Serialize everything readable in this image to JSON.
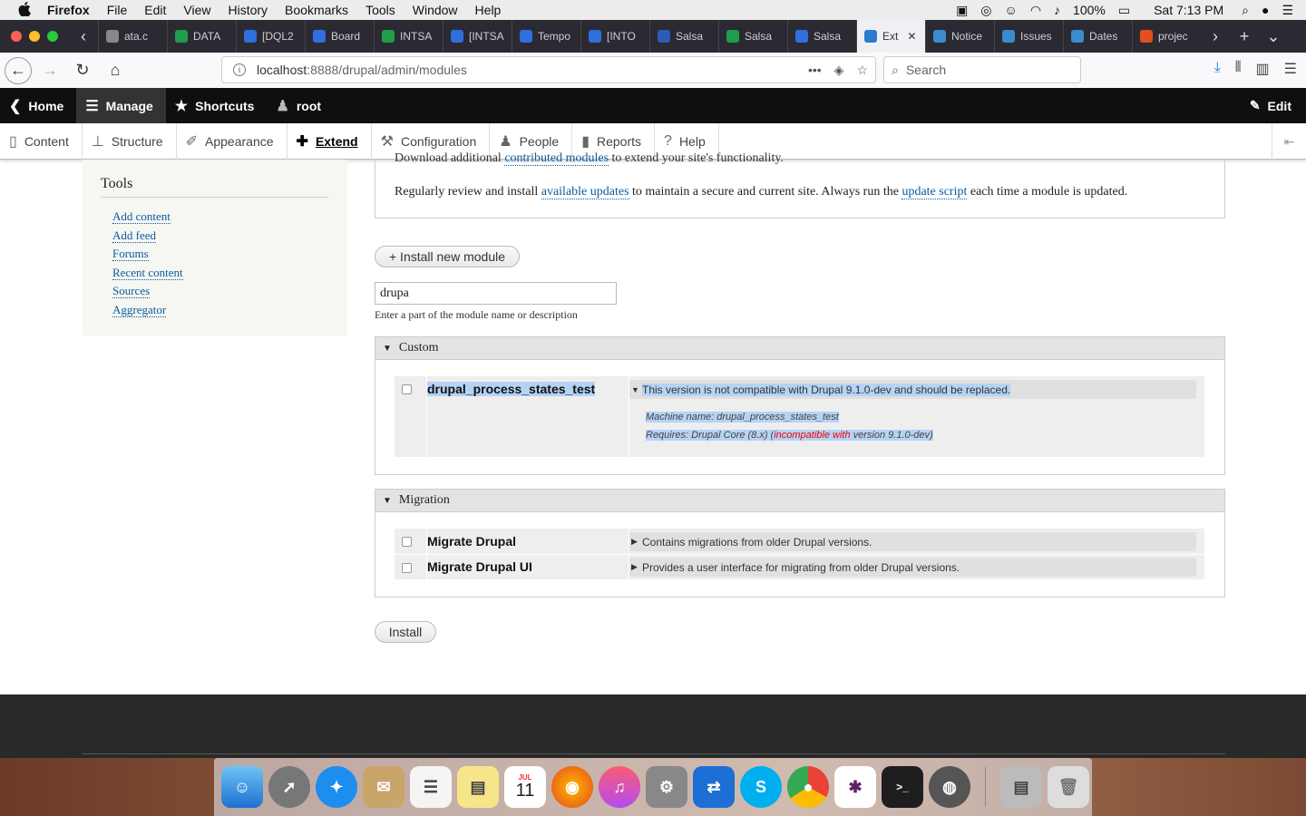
{
  "menubar": {
    "app": "Firefox",
    "items": [
      "File",
      "Edit",
      "View",
      "History",
      "Bookmarks",
      "Tools",
      "Window",
      "Help"
    ],
    "battery": "100%",
    "clock": "Sat 7:13 PM"
  },
  "tabs": [
    {
      "label": "ata.c",
      "color": "#888"
    },
    {
      "label": "DATA",
      "color": "#1e9e4a"
    },
    {
      "label": "[DQL2",
      "color": "#2f6fde"
    },
    {
      "label": "Board",
      "color": "#2f6fde"
    },
    {
      "label": "INTSA",
      "color": "#1e9e4a"
    },
    {
      "label": "[INTSA",
      "color": "#2f6fde"
    },
    {
      "label": "Tempo",
      "color": "#2f6fde"
    },
    {
      "label": "[INTO",
      "color": "#2f6fde"
    },
    {
      "label": "Salsa",
      "color": "#2d5bb5"
    },
    {
      "label": "Salsa",
      "color": "#1e9e4a"
    },
    {
      "label": "Salsa",
      "color": "#2f6fde"
    },
    {
      "label": "Ext",
      "color": "#2b7bcc",
      "active": true
    },
    {
      "label": "Notice",
      "color": "#3a8bd0"
    },
    {
      "label": "Issues",
      "color": "#3a8bd0"
    },
    {
      "label": "Dates",
      "color": "#3a8bd0"
    },
    {
      "label": "projec",
      "color": "#e05020"
    }
  ],
  "navbar": {
    "url_host": "localhost",
    "url_rest": ":8888/drupal/admin/modules",
    "search_placeholder": "Search"
  },
  "admin_toolbar": {
    "items": [
      "Home",
      "Manage",
      "Shortcuts",
      "root"
    ],
    "edit": "Edit"
  },
  "tray": {
    "items": [
      "Content",
      "Structure",
      "Appearance",
      "Extend",
      "Configuration",
      "People",
      "Reports",
      "Help"
    ]
  },
  "sidebar": {
    "title": "Tools",
    "links": [
      "Add content",
      "Add feed",
      "Forums",
      "Recent content",
      "Sources",
      "Aggregator"
    ]
  },
  "help": {
    "line1_pre": "Download additional ",
    "line1_link": "contributed modules",
    "line1_post": " to extend your site's functionality.",
    "line2_pre": "Regularly review and install ",
    "line2_link1": "available updates",
    "line2_mid": " to maintain a secure and current site. Always run the ",
    "line2_link2": "update script",
    "line2_post": " each time a module is updated."
  },
  "install_new_module": "+ Install new module",
  "filter": {
    "value": "drupa",
    "description": "Enter a part of the module name or description"
  },
  "groups": {
    "custom": {
      "title": "Custom",
      "module_name": "drupal_process_states_test",
      "module_desc": "This version is not compatible with Drupal 9.1.0-dev and should be replaced.",
      "machine_name": "Machine name: drupal_process_states_test",
      "requires_pre": "Requires: Drupal Core (8.x) (",
      "requires_bad": "incompatible with",
      "requires_post": " version 9.1.0-dev)"
    },
    "migration": {
      "title": "Migration",
      "modules": [
        {
          "name": "Migrate Drupal",
          "desc": "Contains migrations from older Drupal versions."
        },
        {
          "name": "Migrate Drupal UI",
          "desc": "Provides a user interface for migrating from older Drupal versions."
        }
      ]
    }
  },
  "install_button": "Install",
  "dock": {
    "calendar_month": "JUL",
    "calendar_day": "11"
  }
}
